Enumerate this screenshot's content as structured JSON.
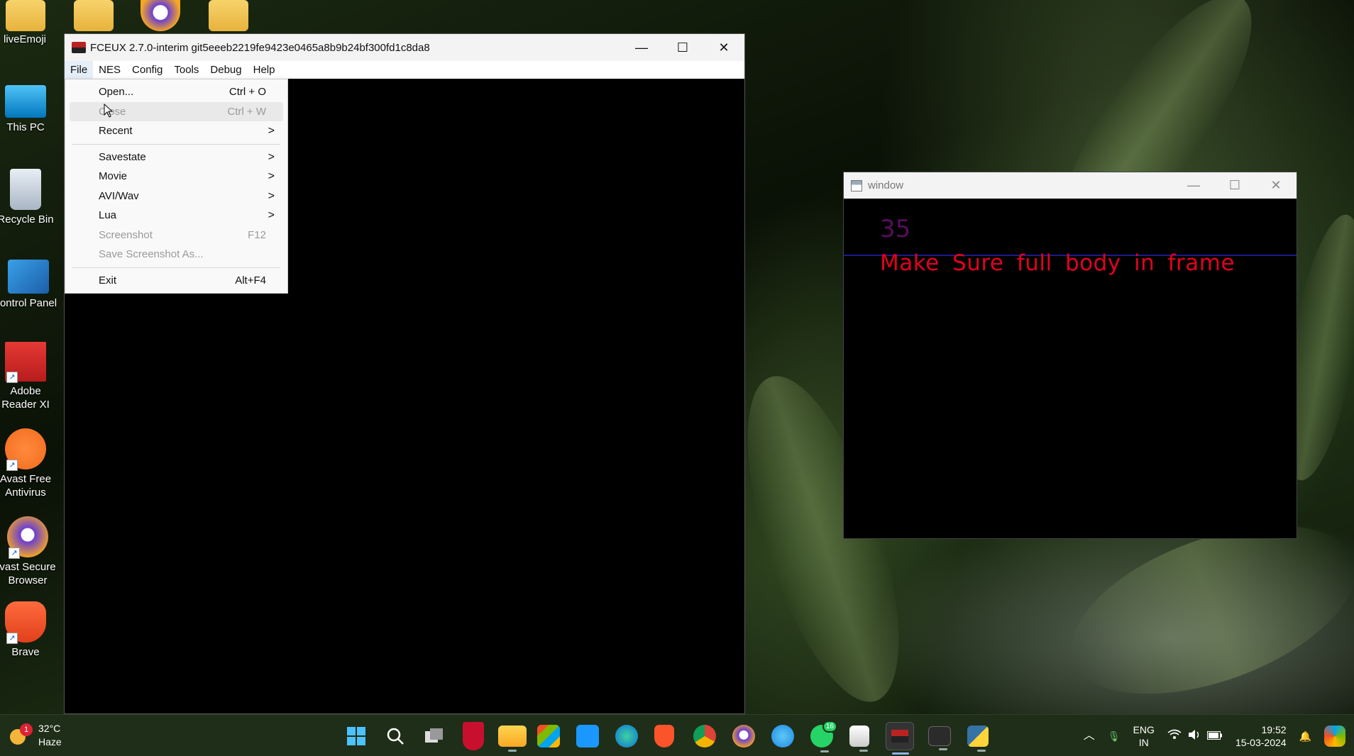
{
  "desktop": {
    "icons": [
      {
        "label": "liveEmoji"
      },
      {
        "label": "This PC"
      },
      {
        "label": "Recycle Bin"
      },
      {
        "label": "ontrol Panel"
      },
      {
        "label": "Adobe Reader XI"
      },
      {
        "label": "Avast Free Antivirus"
      },
      {
        "label": "vast Secure Browser"
      },
      {
        "label": "Brave"
      }
    ]
  },
  "fceux": {
    "title": "FCEUX 2.7.0-interim git5eeeb2219fe9423e0465a8b9b24bf300fd1c8da8",
    "menu": [
      "File",
      "NES",
      "Config",
      "Tools",
      "Debug",
      "Help"
    ],
    "file_menu": [
      {
        "label": "Open...",
        "shortcut": "Ctrl + O"
      },
      {
        "label": "Close",
        "shortcut": "Ctrl + W"
      },
      {
        "label": "Recent",
        "arrow": ">"
      },
      {
        "label": "Savestate",
        "arrow": ">"
      },
      {
        "label": "Movie",
        "arrow": ">"
      },
      {
        "label": "AVI/Wav",
        "arrow": ">"
      },
      {
        "label": "Lua",
        "arrow": ">"
      },
      {
        "label": "Screenshot",
        "shortcut": "F12"
      },
      {
        "label": "Save Screenshot As..."
      },
      {
        "label": "Exit",
        "shortcut": "Alt+F4"
      }
    ],
    "controls": {
      "minimize": "—",
      "maximize": "☐",
      "close": "✕"
    }
  },
  "cv_window": {
    "title": "window",
    "number": "35",
    "message": "Make Sure full body in frame",
    "number_color": "#5a0b5e",
    "message_color": "#e3001f"
  },
  "taskbar": {
    "weather": {
      "temp": "32°C",
      "condition": "Haze",
      "badge": "1"
    },
    "whatsapp_badge": "16",
    "tray": {
      "lang": "ENG",
      "region": "IN",
      "time": "19:52",
      "date": "15-03-2024"
    }
  }
}
